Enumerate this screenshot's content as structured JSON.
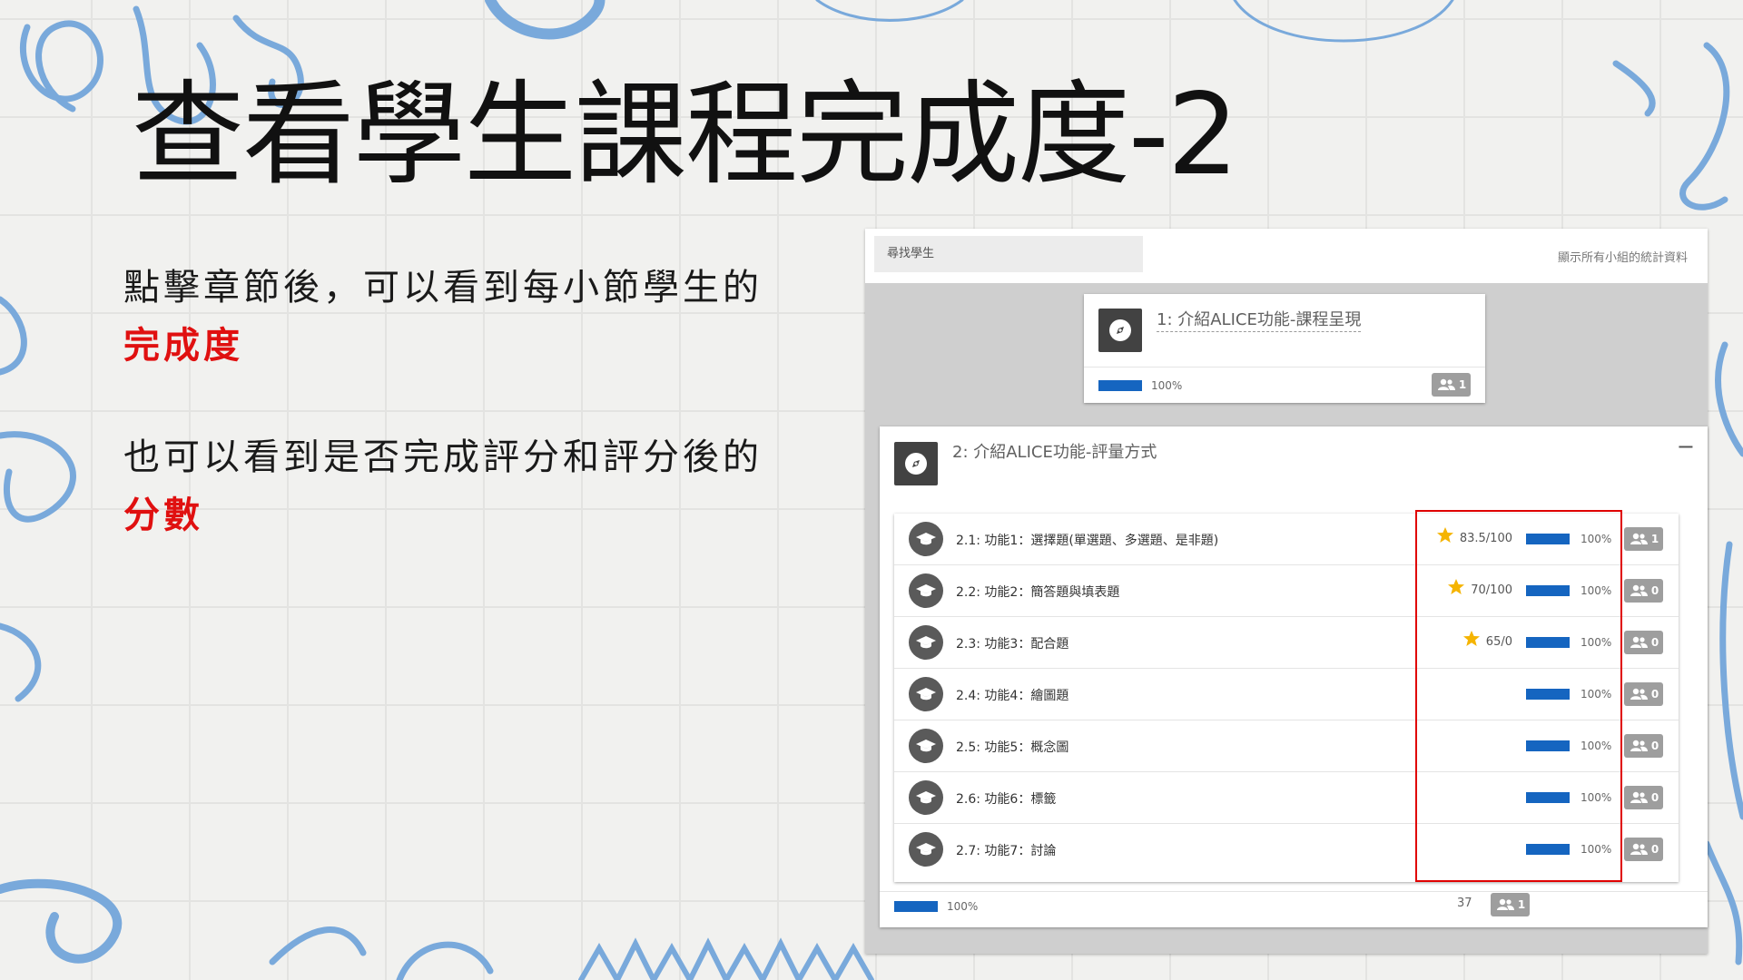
{
  "slide": {
    "title": "查看學生課程完成度-2",
    "desc1_text": "點擊章節後，可以看到每小節學生的",
    "desc1_highlight": "完成度",
    "desc2_text": "也可以看到是否完成評分和評分後的",
    "desc2_highlight": "分數"
  },
  "panel": {
    "search_placeholder": "尋找學生",
    "show_all_label": "顯示所有小組的統計資料",
    "section1": {
      "title": "1: 介紹ALICE功能-課程呈現",
      "progress_label": "100%",
      "progress": 1.0,
      "count": "1"
    },
    "section2": {
      "title": "2: 介紹ALICE功能-評量方式",
      "collapse_label": "−",
      "footer_progress_label": "100%",
      "footer_progress": 1.0,
      "footer_number": "37",
      "footer_count": "1",
      "lessons": [
        {
          "name": "2.1: 功能1：選擇題(單選題、多選題、是非題)",
          "score": "83.5/100",
          "progress_label": "100%",
          "progress": 1.0,
          "count": "1"
        },
        {
          "name": "2.2: 功能2：簡答題與填表題",
          "score": "70/100",
          "progress_label": "100%",
          "progress": 1.0,
          "count": "0"
        },
        {
          "name": "2.3: 功能3：配合題",
          "score": "65/0",
          "progress_label": "100%",
          "progress": 1.0,
          "count": "0"
        },
        {
          "name": "2.4: 功能4：繪圖題",
          "score": "",
          "progress_label": "100%",
          "progress": 1.0,
          "count": "0"
        },
        {
          "name": "2.5: 功能5：概念圖",
          "score": "",
          "progress_label": "100%",
          "progress": 1.0,
          "count": "0"
        },
        {
          "name": "2.6: 功能6：標籤",
          "score": "",
          "progress_label": "100%",
          "progress": 1.0,
          "count": "0"
        },
        {
          "name": "2.7: 功能7：討論",
          "score": "",
          "progress_label": "100%",
          "progress": 1.0,
          "count": "0"
        }
      ]
    }
  },
  "colors": {
    "accent_blue": "#1565c0",
    "highlight_red": "#e01010",
    "star": "#f5b400",
    "doodle": "#79a9db"
  },
  "icons": {
    "section": "compass-icon",
    "lesson": "graduation-cap-icon",
    "score": "star-icon",
    "count": "group-icon"
  }
}
